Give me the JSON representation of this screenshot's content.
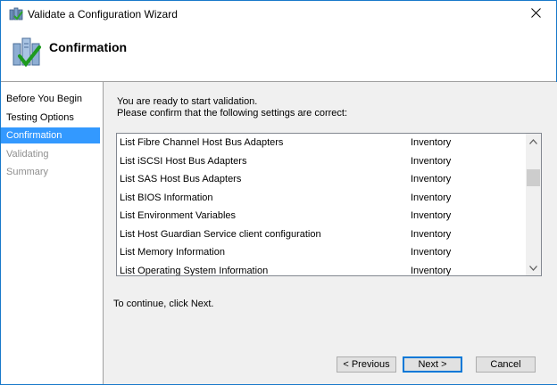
{
  "window": {
    "title": "Validate a Configuration Wizard"
  },
  "header": {
    "title": "Confirmation"
  },
  "sidebar": {
    "items": [
      {
        "label": "Before You Begin",
        "state": "normal"
      },
      {
        "label": "Testing Options",
        "state": "normal"
      },
      {
        "label": "Confirmation",
        "state": "active"
      },
      {
        "label": "Validating",
        "state": "disabled"
      },
      {
        "label": "Summary",
        "state": "disabled"
      }
    ]
  },
  "main": {
    "intro_line1": "You are ready to start validation.",
    "intro_line2": "Please confirm that the following settings are correct:",
    "rows": [
      {
        "name": "List Fibre Channel Host Bus Adapters",
        "category": "Inventory"
      },
      {
        "name": "List iSCSI Host Bus Adapters",
        "category": "Inventory"
      },
      {
        "name": "List SAS Host Bus Adapters",
        "category": "Inventory"
      },
      {
        "name": "List BIOS Information",
        "category": "Inventory"
      },
      {
        "name": "List Environment Variables",
        "category": "Inventory"
      },
      {
        "name": "List Host Guardian Service client configuration",
        "category": "Inventory"
      },
      {
        "name": "List Memory Information",
        "category": "Inventory"
      },
      {
        "name": "List Operating System Information",
        "category": "Inventory"
      }
    ],
    "footer_text": "To continue, click Next."
  },
  "buttons": {
    "previous": "< Previous",
    "next": "Next >",
    "cancel": "Cancel"
  },
  "colors": {
    "accent": "#3399ff",
    "window_border": "#1979ca",
    "content_bg": "#f0f0f0"
  }
}
